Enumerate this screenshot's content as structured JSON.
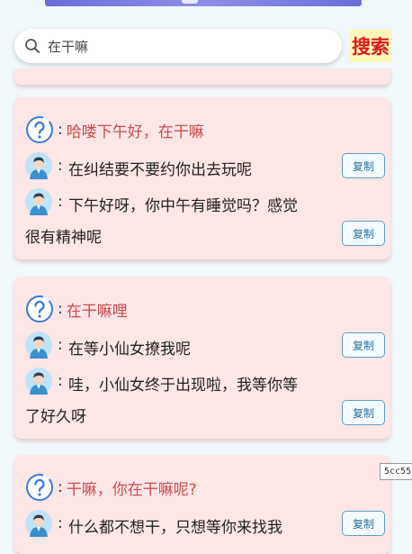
{
  "search": {
    "value": "在干嘛",
    "button_label": "搜索"
  },
  "side_tag": "5cc55",
  "copy_label": "复制",
  "cards": [
    {
      "question": "哈喽下午好，在干嘛",
      "answers": [
        {
          "line1": "在纠结要不要约你出去玩呢",
          "line2": ""
        },
        {
          "line1": "下午好呀，你中午有睡觉吗？感觉",
          "line2": "很有精神呢"
        }
      ]
    },
    {
      "question": "在干嘛哩",
      "answers": [
        {
          "line1": "在等小仙女撩我呢",
          "line2": ""
        },
        {
          "line1": "哇，小仙女终于出现啦，我等你等",
          "line2": "了好久呀"
        }
      ]
    },
    {
      "question": "干嘛，你在干嘛呢?",
      "answers": [
        {
          "line1": "什么都不想干，只想等你来找我",
          "line2": ""
        }
      ]
    }
  ]
}
